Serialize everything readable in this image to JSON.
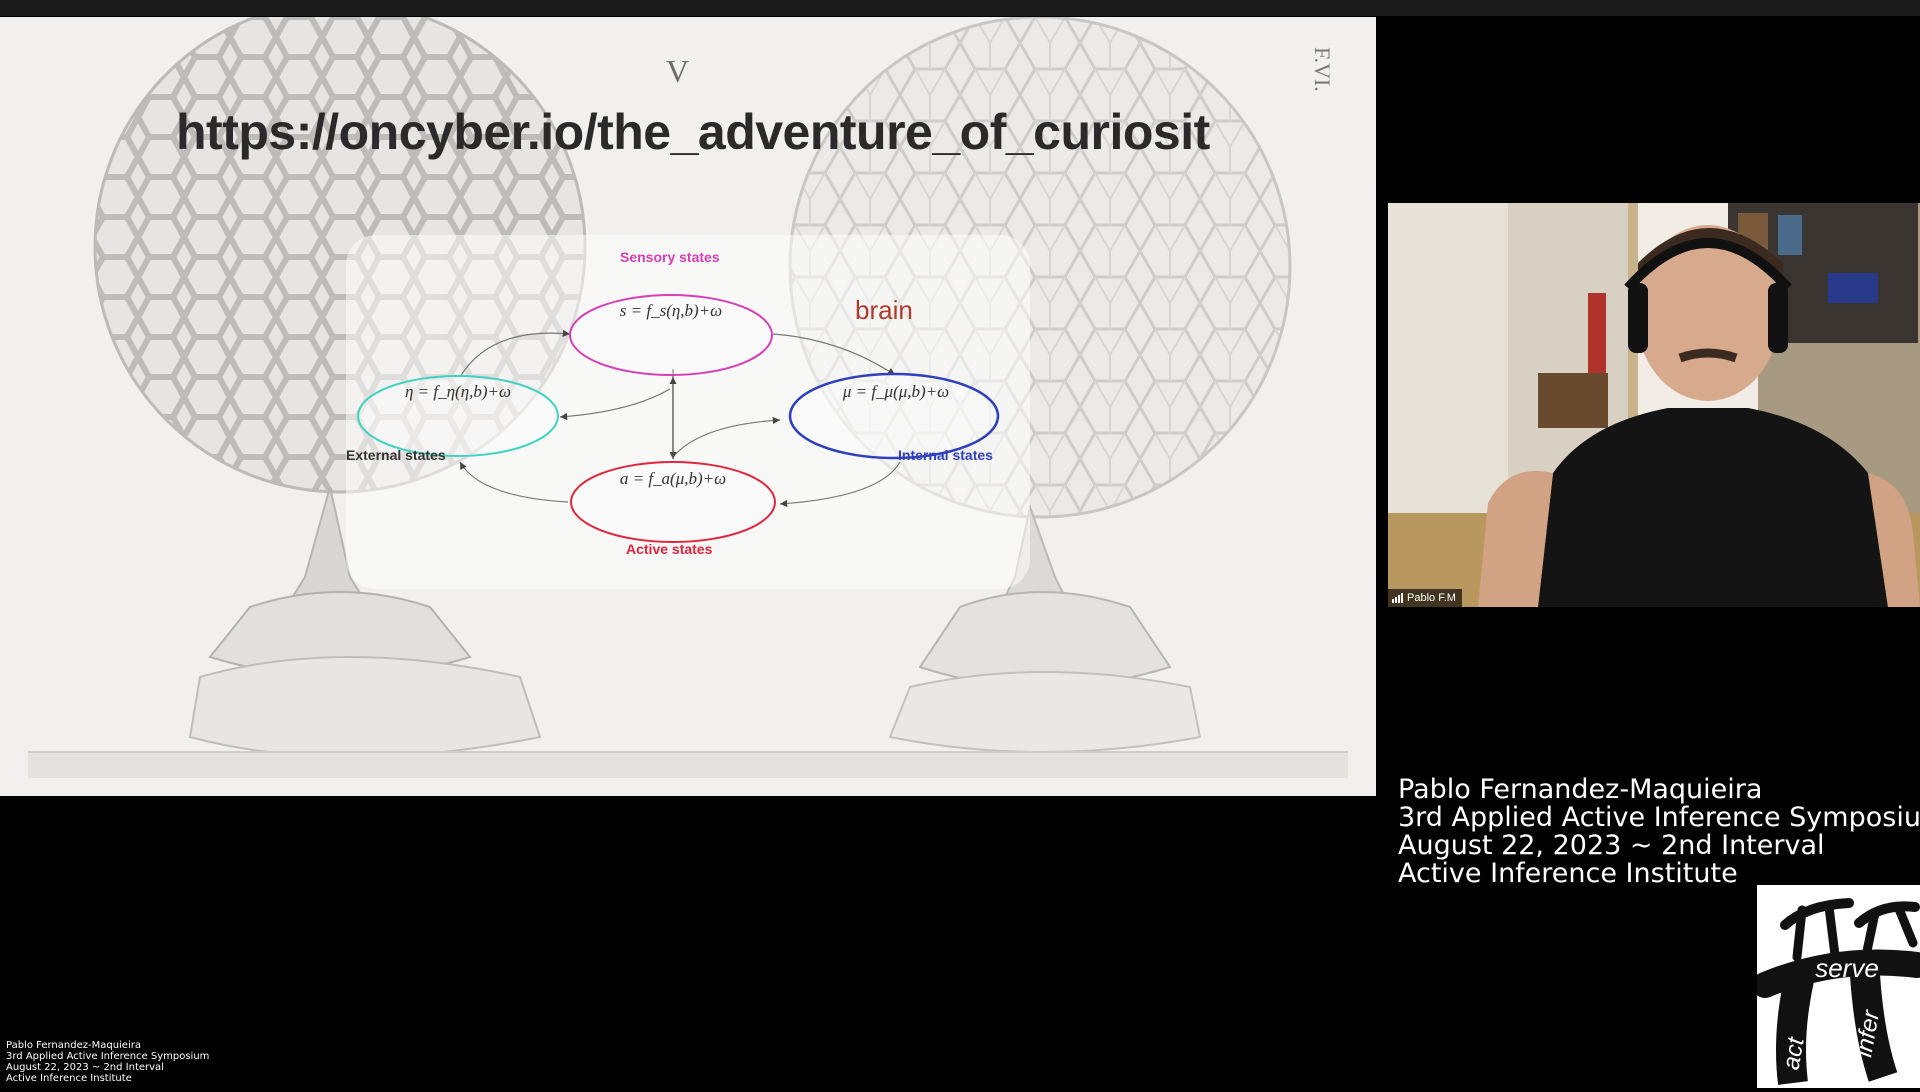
{
  "slide": {
    "url_text": "https://oncyber.io/the_adventure_of_curiosit",
    "corner_numeral": "F.VI.",
    "top_mark": "V",
    "diagram": {
      "sensory": {
        "label": "Sensory states",
        "equation": "s = f_s(η,b)+ω",
        "color": "#d63fb8"
      },
      "external": {
        "label": "External states",
        "equation": "η = f_η(η,b)+ω",
        "color": "#3fd2c0"
      },
      "internal": {
        "label": "Internal states",
        "equation": "μ = f_μ(μ,b)+ω",
        "color": "#2f3fbe"
      },
      "active": {
        "label": "Active states",
        "equation": "a = f_a(μ,b)+ω",
        "color": "#e0253e"
      },
      "brain_label": "brain"
    }
  },
  "camera": {
    "participant_name": "Pablo F.M"
  },
  "caption": {
    "lines": [
      "Pablo Fernandez-Maquieira",
      "3rd Applied Active Inference Symposium",
      "August 22, 2023 ~ 2nd Interval",
      "Active Inference Institute"
    ]
  },
  "logo": {
    "serve": "serve",
    "act": "act",
    "infer": "infer"
  }
}
